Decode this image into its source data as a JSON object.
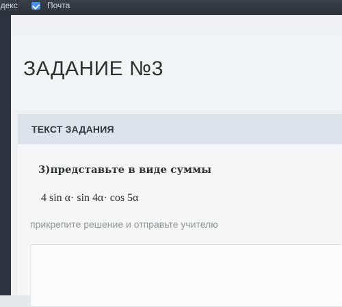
{
  "bookmarks": [
    {
      "label": "ндекс"
    },
    {
      "label": "Почта",
      "icon": "mail-icon"
    }
  ],
  "page": {
    "title": "ЗАДАНИЕ №3"
  },
  "task_card": {
    "header": "ТЕКСТ ЗАДАНИЯ",
    "task_text": "3)представьте в виде суммы",
    "formula": "4 sin α· sin 4α· cos 5α",
    "instruction": "прикрепите решение и отправьте учителю"
  },
  "colors": {
    "bookmarks_bar": "#2c3039",
    "card_header": "#dde3ea",
    "mail_icon": "#3d8ff3"
  }
}
